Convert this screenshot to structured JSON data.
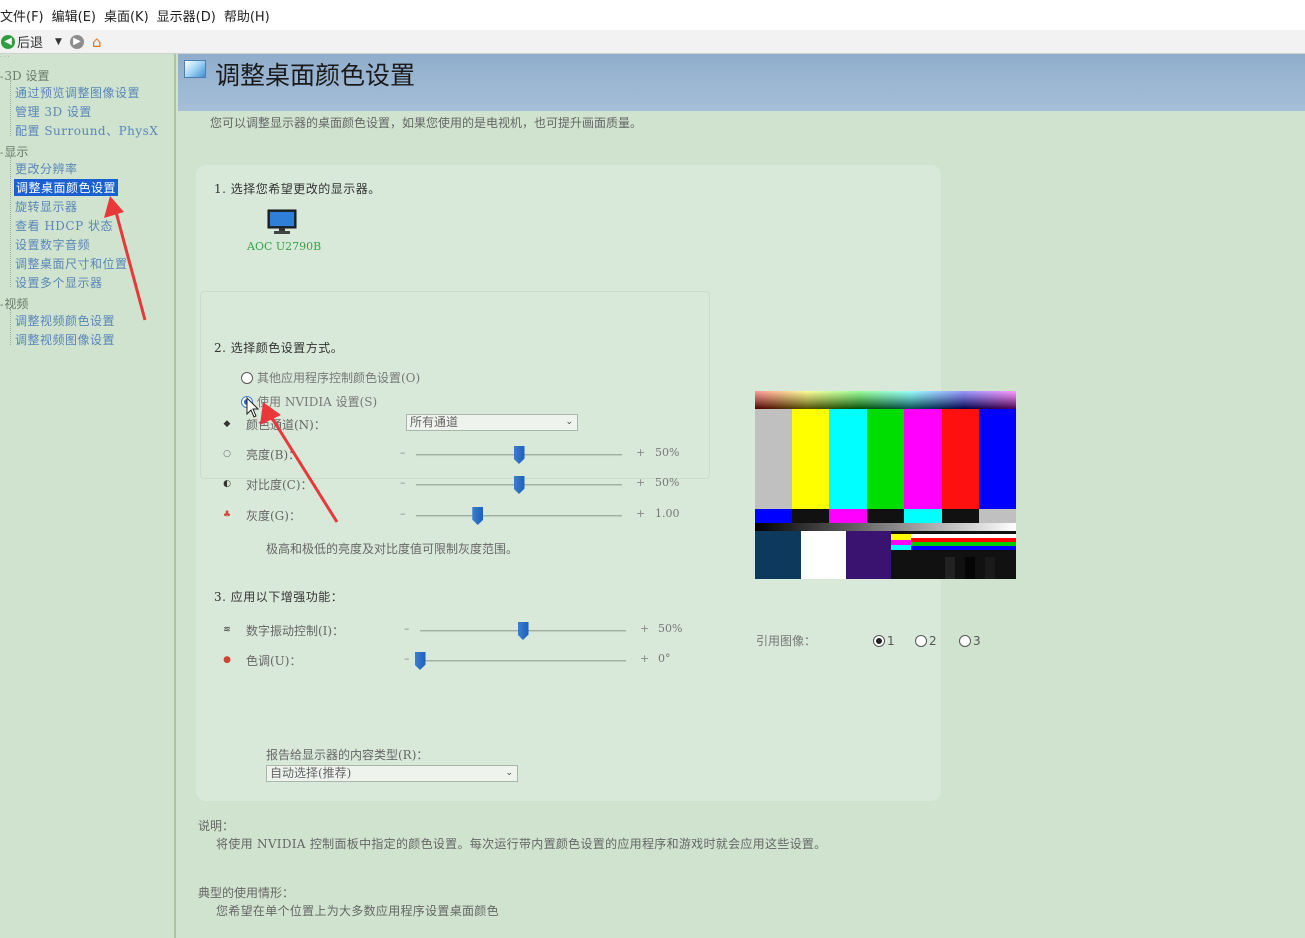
{
  "menu": {
    "file": "文件(F)",
    "edit": "编辑(E)",
    "desktop": "桌面(K)",
    "display": "显示器(D)",
    "help": "帮助(H)"
  },
  "toolbar": {
    "back_label": "后退",
    "back_icon": "back-arrow-icon",
    "forward_icon": "forward-arrow-icon",
    "home_icon": "home-icon"
  },
  "sidebar": {
    "categories": [
      {
        "label": "3D 设置",
        "items": [
          "通过预览调整图像设置",
          "管理 3D 设置",
          "配置 Surround、PhysX"
        ]
      },
      {
        "label": "显示",
        "items": [
          "更改分辨率",
          "调整桌面颜色设置",
          "旋转显示器",
          "查看 HDCP 状态",
          "设置数字音频",
          "调整桌面尺寸和位置",
          "设置多个显示器"
        ],
        "selected": "调整桌面颜色设置"
      },
      {
        "label": "视频",
        "items": [
          "调整视频颜色设置",
          "调整视频图像设置"
        ]
      }
    ]
  },
  "page": {
    "title": "调整桌面颜色设置",
    "description": "您可以调整显示器的桌面颜色设置，如果您使用的是电视机，也可提升画面质量。"
  },
  "step1": {
    "heading": "1. 选择您希望更改的显示器。",
    "monitor_name": "AOC U2790B"
  },
  "step2": {
    "heading": "2. 选择颜色设置方式。",
    "option_other": "其他应用程序控制颜色设置(O)",
    "option_nvidia": "使用 NVIDIA 设置(S)",
    "selected": "nvidia",
    "color_channel_label": "颜色通道(N)：",
    "color_channel_value": "所有通道",
    "brightness": {
      "label": "亮度(B)：",
      "value": "50%",
      "level": 0.5
    },
    "contrast": {
      "label": "对比度(C)：",
      "value": "50%",
      "level": 0.5
    },
    "gamma": {
      "label": "灰度(G)：",
      "value": "1.00",
      "level": 0.3
    },
    "note": "极高和极低的亮度及对比度值可限制灰度范围。"
  },
  "step3": {
    "heading": "3. 应用以下增强功能：",
    "digital_vibrance": {
      "label": "数字振动控制(I)：",
      "value": "50%",
      "level": 0.5
    },
    "hue": {
      "label": "色调(U)：",
      "value": "0°",
      "level": 0.0
    },
    "content_type_label": "报告给显示器的内容类型(R)：",
    "content_type_value": "自动选择(推荐)"
  },
  "reference": {
    "label": "引用图像：",
    "options": [
      "1",
      "2",
      "3"
    ],
    "selected": "1"
  },
  "help": {
    "description_title": "说明：",
    "description_text": "将使用 NVIDIA 控制面板中指定的颜色设置。每次运行带内置颜色设置的应用程序和游戏时就会应用这些设置。",
    "usage_title": "典型的使用情形：",
    "usage_text": "您希望在单个位置上为大多数应用程序设置桌面颜色"
  },
  "colors": {
    "sidebar_bg": "#cfe3cf",
    "banner": "#9ab6d3",
    "selected_item": "#1b60d2",
    "link": "#5a86b8",
    "slider_thumb": "#2a6fc6",
    "annotation_arrow": "#e8383a"
  }
}
